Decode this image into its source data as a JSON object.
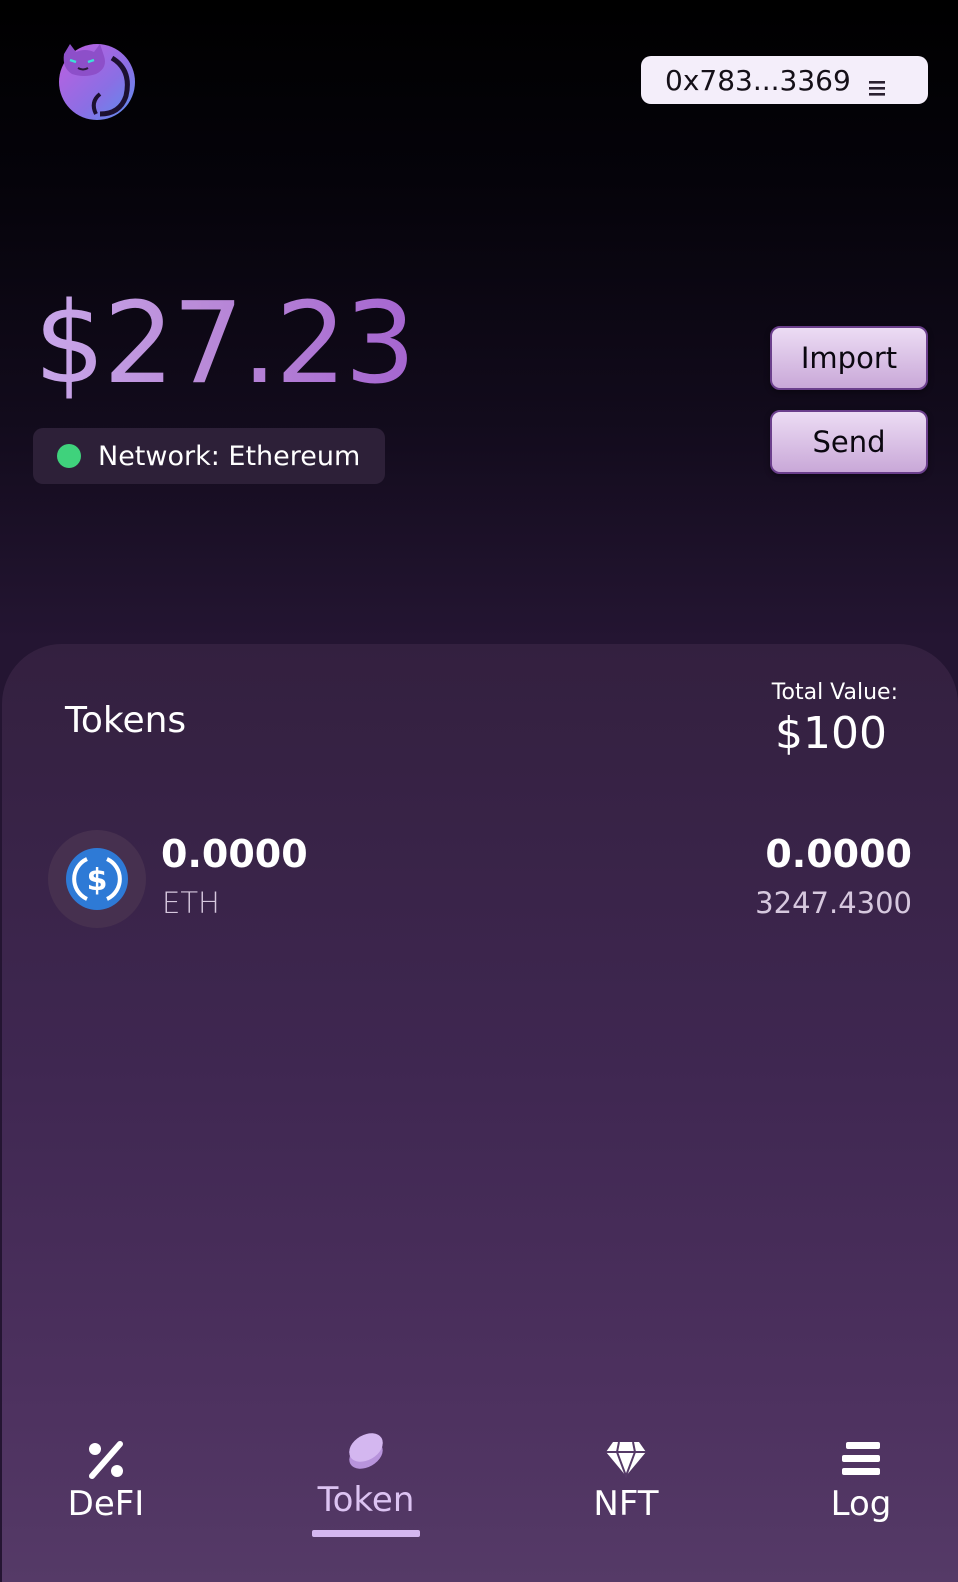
{
  "header": {
    "address": "0x783...3369",
    "menu_icon": "menu-icon",
    "logo_icon": "cat-logo-icon"
  },
  "wallet": {
    "balance": "$27.23",
    "network_label": "Network: Ethereum",
    "network_status_color": "#3fd27c"
  },
  "actions": {
    "import_label": "Import",
    "send_label": "Send"
  },
  "tokens": {
    "title": "Tokens",
    "total_label": "Total Value:",
    "total_value": "$100",
    "items": [
      {
        "icon": "usd-coin-icon",
        "amount": "0.0000",
        "symbol": "ETH",
        "value": "0.0000",
        "price": "3247.4300"
      }
    ]
  },
  "nav": {
    "items": [
      {
        "label": "DeFI",
        "icon": "percent-icon",
        "active": false
      },
      {
        "label": "Token",
        "icon": "coin-icon",
        "active": true
      },
      {
        "label": "NFT",
        "icon": "diamond-icon",
        "active": false
      },
      {
        "label": "Log",
        "icon": "list-icon",
        "active": false
      }
    ]
  },
  "colors": {
    "accent": "#d4b7f0",
    "panel": "#3f2751"
  }
}
